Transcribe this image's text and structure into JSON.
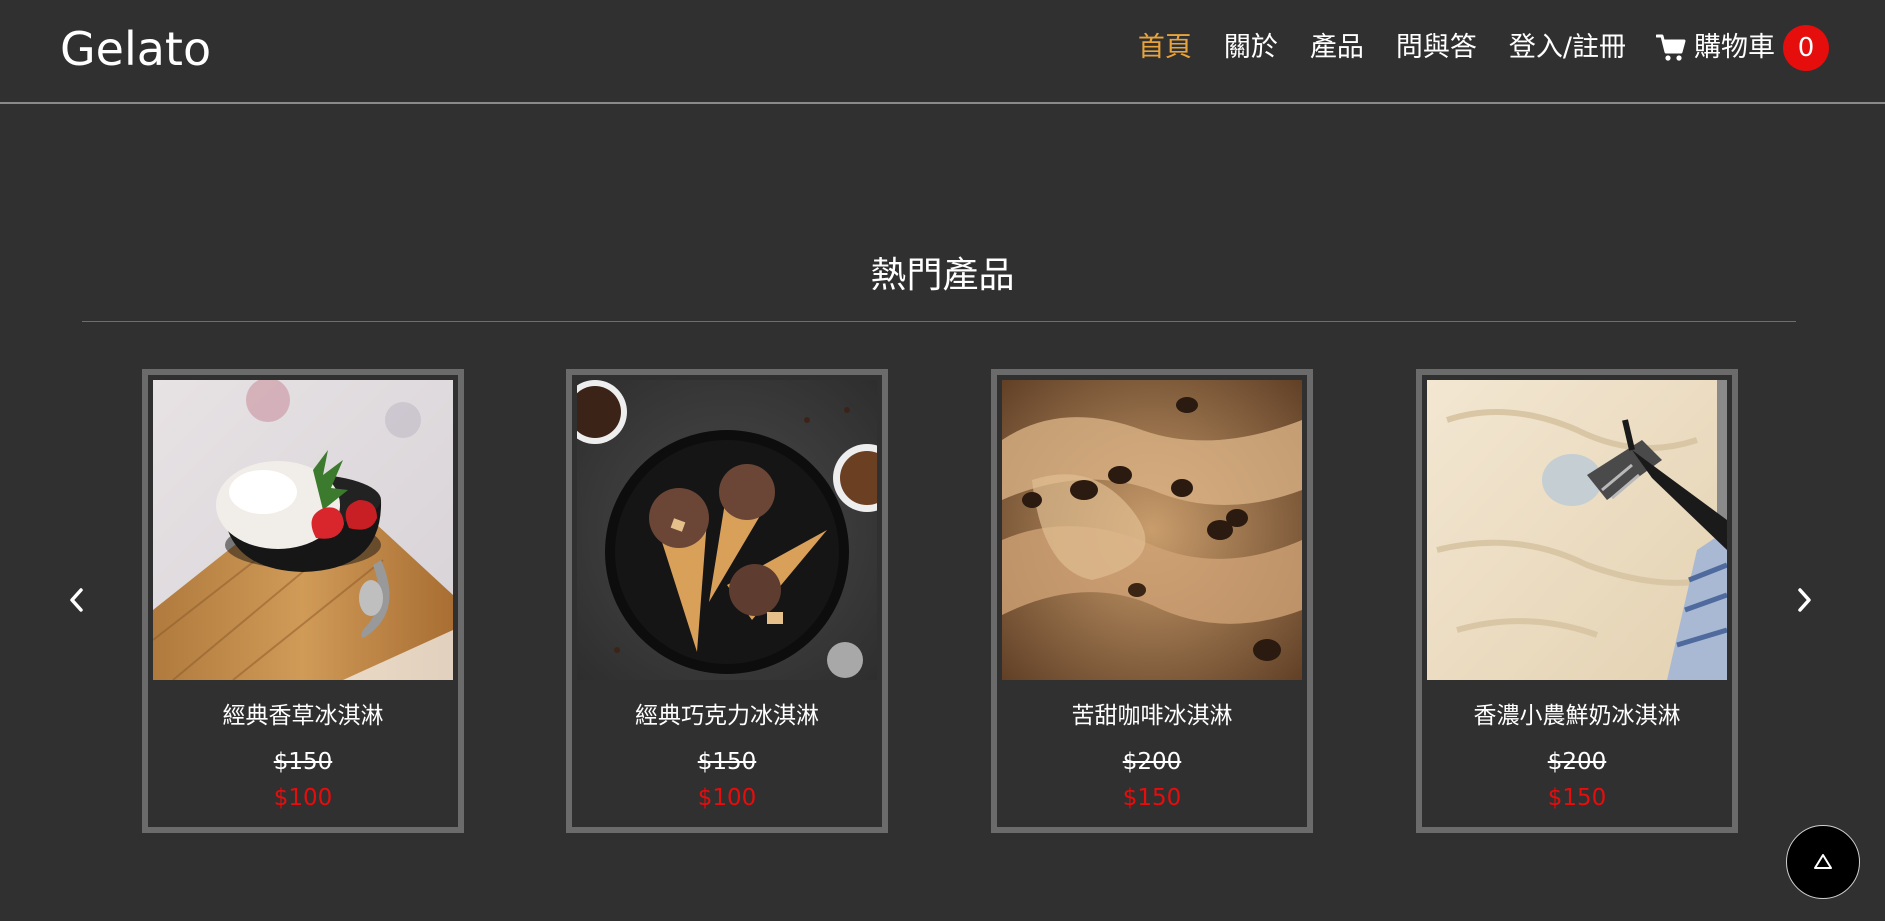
{
  "header": {
    "brand": "Gelato",
    "nav": [
      {
        "label": "首頁",
        "active": true
      },
      {
        "label": "關於",
        "active": false
      },
      {
        "label": "產品",
        "active": false
      },
      {
        "label": "問與答",
        "active": false
      },
      {
        "label": "登入/註冊",
        "active": false
      }
    ],
    "cart": {
      "icon": "shopping-cart-icon",
      "label": "購物車",
      "count": "0"
    }
  },
  "section": {
    "title": "熱門產品"
  },
  "carousel": {
    "prev_icon": "chevron-left-icon",
    "next_icon": "chevron-right-icon",
    "products": [
      {
        "name": "經典香草冰淇淋",
        "old_price": "$150",
        "price": "$100",
        "image": "vanilla-ice-cream-bowl"
      },
      {
        "name": "經典巧克力冰淇淋",
        "old_price": "$150",
        "price": "$100",
        "image": "chocolate-ice-cream-cones"
      },
      {
        "name": "苦甜咖啡冰淇淋",
        "old_price": "$200",
        "price": "$150",
        "image": "coffee-ice-cream"
      },
      {
        "name": "香濃小農鮮奶冰淇淋",
        "old_price": "$200",
        "price": "$150",
        "image": "milk-ice-cream-scoop"
      }
    ]
  },
  "back_to_top": {
    "icon": "triangle-up-icon"
  },
  "colors": {
    "background": "#303030",
    "active_nav": "#e8a33c",
    "price_red": "#e60d0d",
    "card_border": "#6b6b6b"
  }
}
